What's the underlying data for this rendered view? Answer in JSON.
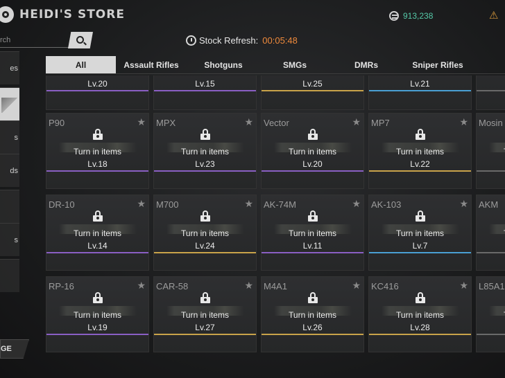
{
  "header": {
    "title": "HEIDI'S STORE",
    "currency_icon": "coin-icon",
    "currency_amount": "913,238",
    "currency_color": "#55c9a8",
    "warning_icon": "warning-triangle-icon"
  },
  "search": {
    "placeholder": "rch"
  },
  "stock_refresh": {
    "label": "Stock Refresh:",
    "time": "00:05:48",
    "time_color": "#ef8a3c"
  },
  "sidebar": {
    "items": [
      {
        "label": "es",
        "active": false
      },
      {
        "label": "",
        "active": true
      },
      {
        "label": "s",
        "active": false
      },
      {
        "label": "ds",
        "active": false
      },
      {
        "label": "",
        "active": false
      },
      {
        "label": "s",
        "active": false
      },
      {
        "label": "",
        "active": false
      }
    ],
    "bottom_button": "GE"
  },
  "tabs": [
    {
      "label": "All",
      "active": true
    },
    {
      "label": "Assault Rifles",
      "active": false
    },
    {
      "label": "Shotguns",
      "active": false
    },
    {
      "label": "SMGs",
      "active": false
    },
    {
      "label": "DMRs",
      "active": false
    },
    {
      "label": "Sniper Rifles",
      "active": false
    }
  ],
  "status_text": "Turn in items",
  "rarity_colors": {
    "purple": "#8a5fc4",
    "gold": "#c9a34a",
    "blue": "#4a9fd4",
    "gray": "#6a6a6a"
  },
  "top_row": [
    {
      "level": "Lv.20",
      "rarity": "purple"
    },
    {
      "level": "Lv.15",
      "rarity": "purple"
    },
    {
      "level": "Lv.25",
      "rarity": "gold"
    },
    {
      "level": "Lv.21",
      "rarity": "blue"
    },
    {
      "level": "",
      "rarity": "gray"
    }
  ],
  "rows": [
    [
      {
        "name": "P90",
        "level": "Lv.18",
        "rarity": "purple",
        "locked": true
      },
      {
        "name": "MPX",
        "level": "Lv.23",
        "rarity": "purple",
        "locked": false
      },
      {
        "name": "Vector",
        "level": "Lv.20",
        "rarity": "purple",
        "locked": false
      },
      {
        "name": "MP7",
        "level": "Lv.22",
        "rarity": "gold",
        "locked": true
      },
      {
        "name": "Mosin",
        "level": "",
        "rarity": "gray",
        "locked": true
      }
    ],
    [
      {
        "name": "DR-10",
        "level": "Lv.14",
        "rarity": "purple",
        "locked": true
      },
      {
        "name": "M700",
        "level": "Lv.24",
        "rarity": "gold",
        "locked": true
      },
      {
        "name": "AK-74M",
        "level": "Lv.11",
        "rarity": "purple",
        "locked": true
      },
      {
        "name": "AK-103",
        "level": "Lv.7",
        "rarity": "blue",
        "locked": true
      },
      {
        "name": "AKM",
        "level": "",
        "rarity": "gray",
        "locked": true
      }
    ],
    [
      {
        "name": "RP-16",
        "level": "Lv.19",
        "rarity": "purple",
        "locked": true
      },
      {
        "name": "CAR-58",
        "level": "Lv.27",
        "rarity": "gold",
        "locked": true
      },
      {
        "name": "M4A1",
        "level": "Lv.26",
        "rarity": "gold",
        "locked": true
      },
      {
        "name": "KC416",
        "level": "Lv.28",
        "rarity": "gold",
        "locked": true
      },
      {
        "name": "L85A1",
        "level": "",
        "rarity": "gray",
        "locked": true
      }
    ]
  ]
}
